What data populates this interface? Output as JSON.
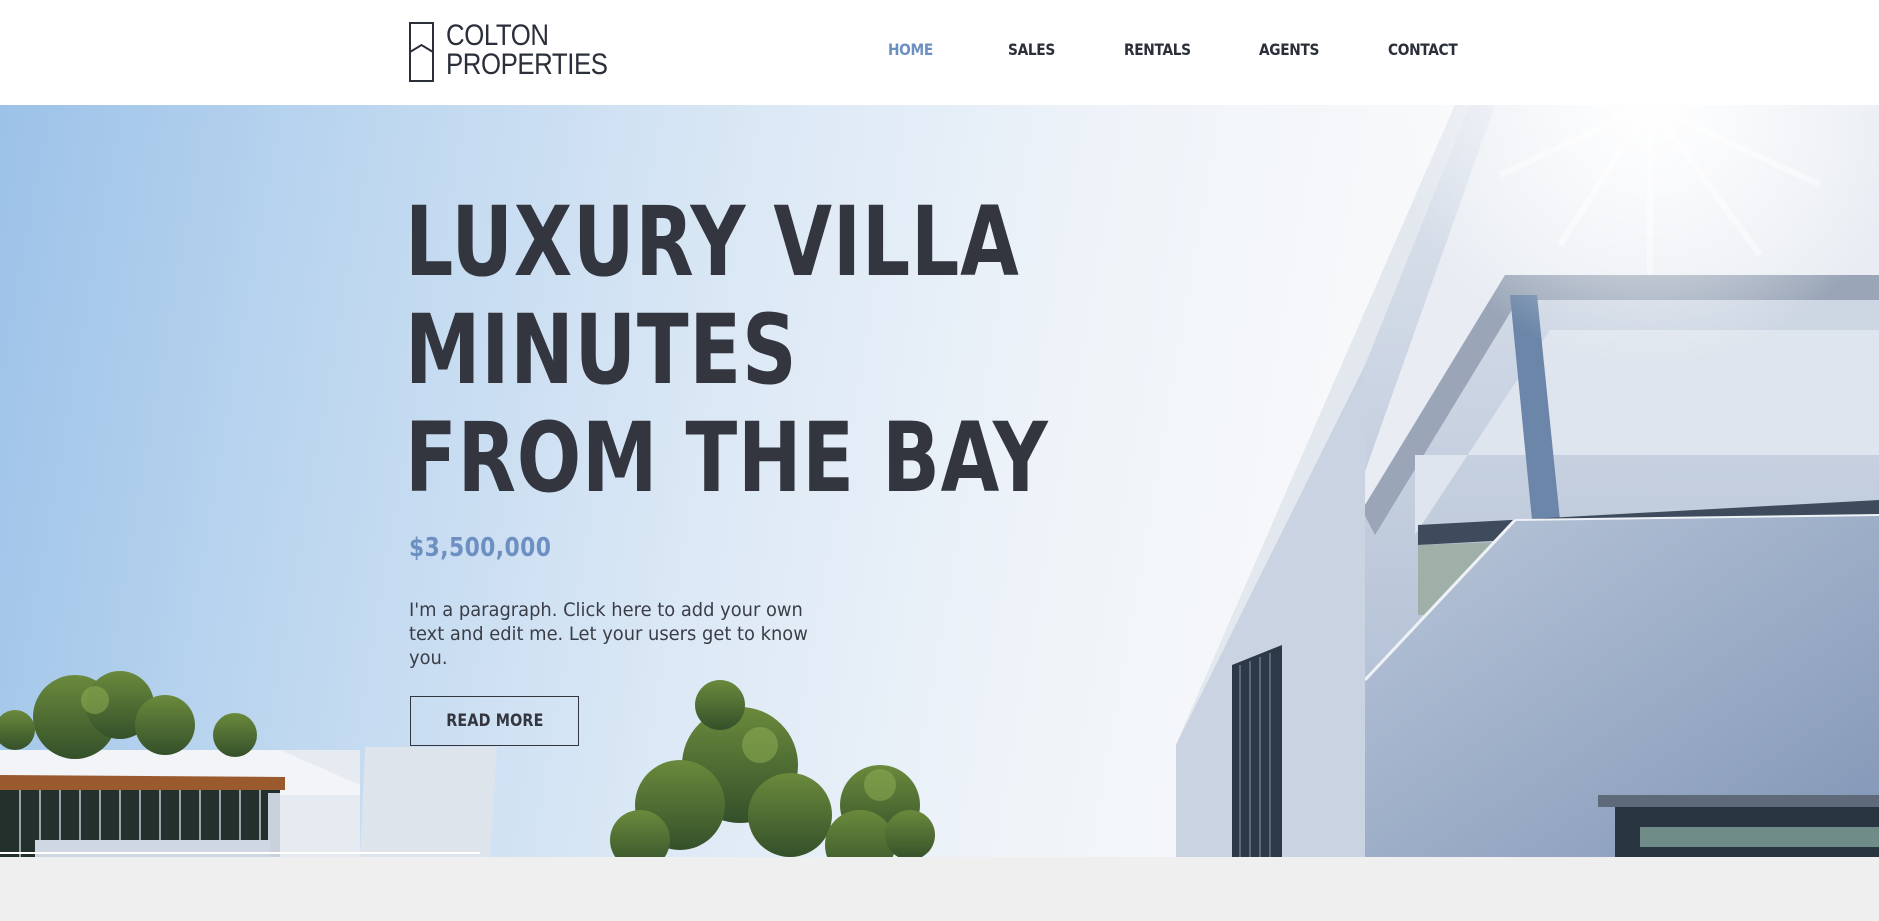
{
  "brand": {
    "name_line1": "COLTON",
    "name_line2": "PROPERTIES",
    "logo_icon": "house-outline-icon"
  },
  "nav": {
    "items": [
      {
        "label": "HOME",
        "active": true
      },
      {
        "label": "SALES",
        "active": false
      },
      {
        "label": "RENTALS",
        "active": false
      },
      {
        "label": "AGENTS",
        "active": false
      },
      {
        "label": "CONTACT",
        "active": false
      }
    ]
  },
  "hero": {
    "headline_lines": [
      "LUXURY VILLA",
      "MINUTES",
      "FROM THE BAY"
    ],
    "price": "$3,500,000",
    "paragraph": "I'm a paragraph. Click here to add your own text and edit me. Let your users get to know you.",
    "button_label": "READ MORE",
    "background_image": "modern-white-villa-sky-photo"
  },
  "colors": {
    "text_dark": "#33353f",
    "accent": "#6e8fc2",
    "footer_strip": "#efefef"
  }
}
